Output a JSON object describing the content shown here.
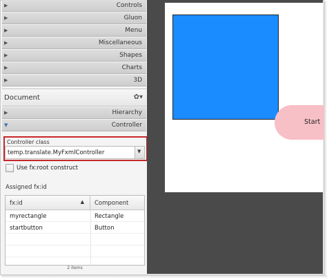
{
  "library": {
    "sections": [
      {
        "label": "Controls"
      },
      {
        "label": "Gluon"
      },
      {
        "label": "Menu"
      },
      {
        "label": "Miscellaneous"
      },
      {
        "label": "Shapes"
      },
      {
        "label": "Charts"
      },
      {
        "label": "3D"
      }
    ]
  },
  "document": {
    "title": "Document",
    "gear_glyph": "✿▾",
    "hierarchy_label": "Hierarchy",
    "controller_label": "Controller"
  },
  "controller": {
    "class_label": "Controller class",
    "class_value": "temp.translate.MyFxmlController",
    "use_fxroot_label": "Use fx:root construct",
    "use_fxroot_checked": false,
    "assigned_label": "Assigned fx:id",
    "table": {
      "columns": [
        "fx:id",
        "Component"
      ],
      "rows": [
        {
          "fxid": "myrectangle",
          "component": "Rectangle"
        },
        {
          "fxid": "startbutton",
          "component": "Button"
        }
      ]
    },
    "items_count": "2 items"
  },
  "canvas": {
    "rectangle_color": "#1b8cff",
    "start_button_label": "Start",
    "start_button_color": "#f7bfc6",
    "highlight_color": "#c8262a"
  }
}
